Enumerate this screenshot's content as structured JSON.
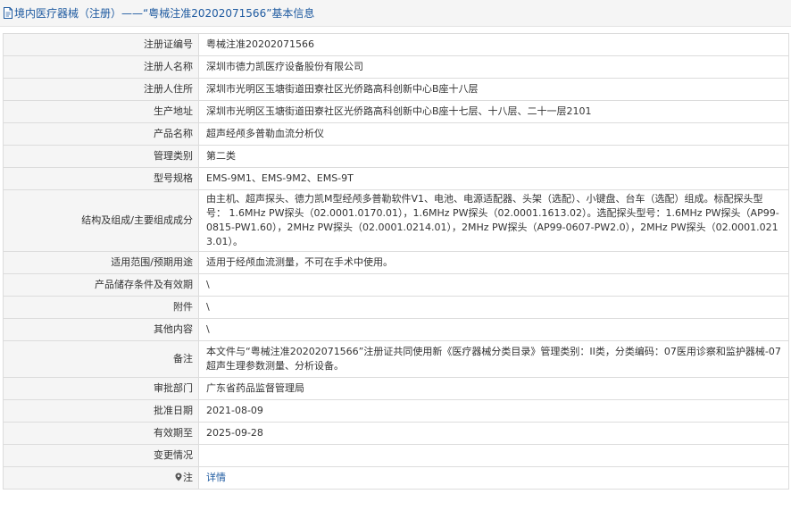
{
  "header": {
    "title": "境内医疗器械（注册）——“粤械注准20202071566”基本信息"
  },
  "rows": [
    {
      "label": "注册证编号",
      "value": "粤械注准20202071566"
    },
    {
      "label": "注册人名称",
      "value": "深圳市德力凯医疗设备股份有限公司"
    },
    {
      "label": "注册人住所",
      "value": "深圳市光明区玉塘街道田寮社区光侨路高科创新中心B座十八层"
    },
    {
      "label": "生产地址",
      "value": "深圳市光明区玉塘街道田寮社区光侨路高科创新中心B座十七层、十八层、二十一层2101"
    },
    {
      "label": "产品名称",
      "value": "超声经颅多普勒血流分析仪"
    },
    {
      "label": "管理类别",
      "value": "第二类"
    },
    {
      "label": "型号规格",
      "value": "EMS-9M1、EMS-9M2、EMS-9T"
    },
    {
      "label": "结构及组成/主要组成成分",
      "value": "由主机、超声探头、德力凯M型经颅多普勒软件V1、电池、电源适配器、头架（选配）、小键盘、台车（选配）组成。标配探头型号： 1.6MHz PW探头（02.0001.0170.01），1.6MHz PW探头（02.0001.1613.02）。选配探头型号：1.6MHz PW探头（AP99-0815-PW1.60），2MHz PW探头（02.0001.0214.01），2MHz PW探头（AP99-0607-PW2.0），2MHz PW探头（02.0001.0213.01）。"
    },
    {
      "label": "适用范围/预期用途",
      "value": "适用于经颅血流测量，不可在手术中使用。"
    },
    {
      "label": "产品储存条件及有效期",
      "value": "\\"
    },
    {
      "label": "附件",
      "value": "\\"
    },
    {
      "label": "其他内容",
      "value": "\\"
    },
    {
      "label": "备注",
      "value": "本文件与“粤械注准20202071566”注册证共同使用新《医疗器械分类目录》管理类别：II类，分类编码：07医用诊察和监护器械-07超声生理参数测量、分析设备。"
    },
    {
      "label": "审批部门",
      "value": "广东省药品监督管理局"
    },
    {
      "label": "批准日期",
      "value": "2021-08-09"
    },
    {
      "label": "有效期至",
      "value": "2025-09-28"
    },
    {
      "label": "变更情况",
      "value": ""
    },
    {
      "label": "注",
      "value": "详情"
    }
  ],
  "icons": {
    "header": "document-icon",
    "note": "map-pin-icon"
  },
  "colors": {
    "link": "#1e5aa0",
    "label_bg": "#f5f5f5",
    "border": "#dcdcdc"
  }
}
